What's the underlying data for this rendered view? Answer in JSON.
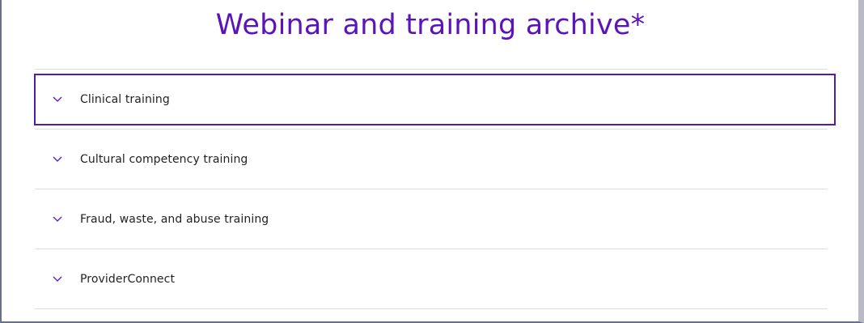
{
  "page": {
    "title": "Webinar and training archive*"
  },
  "accordion": {
    "items": [
      {
        "label": "Clinical training",
        "icon": "chevron-down-icon",
        "focused": true
      },
      {
        "label": "Cultural competency training",
        "icon": "chevron-down-icon",
        "focused": false
      },
      {
        "label": "Fraud, waste, and abuse training",
        "icon": "chevron-down-icon",
        "focused": false
      },
      {
        "label": "ProviderConnect",
        "icon": "chevron-down-icon",
        "focused": false
      }
    ]
  },
  "colors": {
    "title": "#5a14b8",
    "focus_outline": "#4f1bb0",
    "chevron": "#5a14b8",
    "divider": "#dcdce0",
    "label": "#222222"
  }
}
